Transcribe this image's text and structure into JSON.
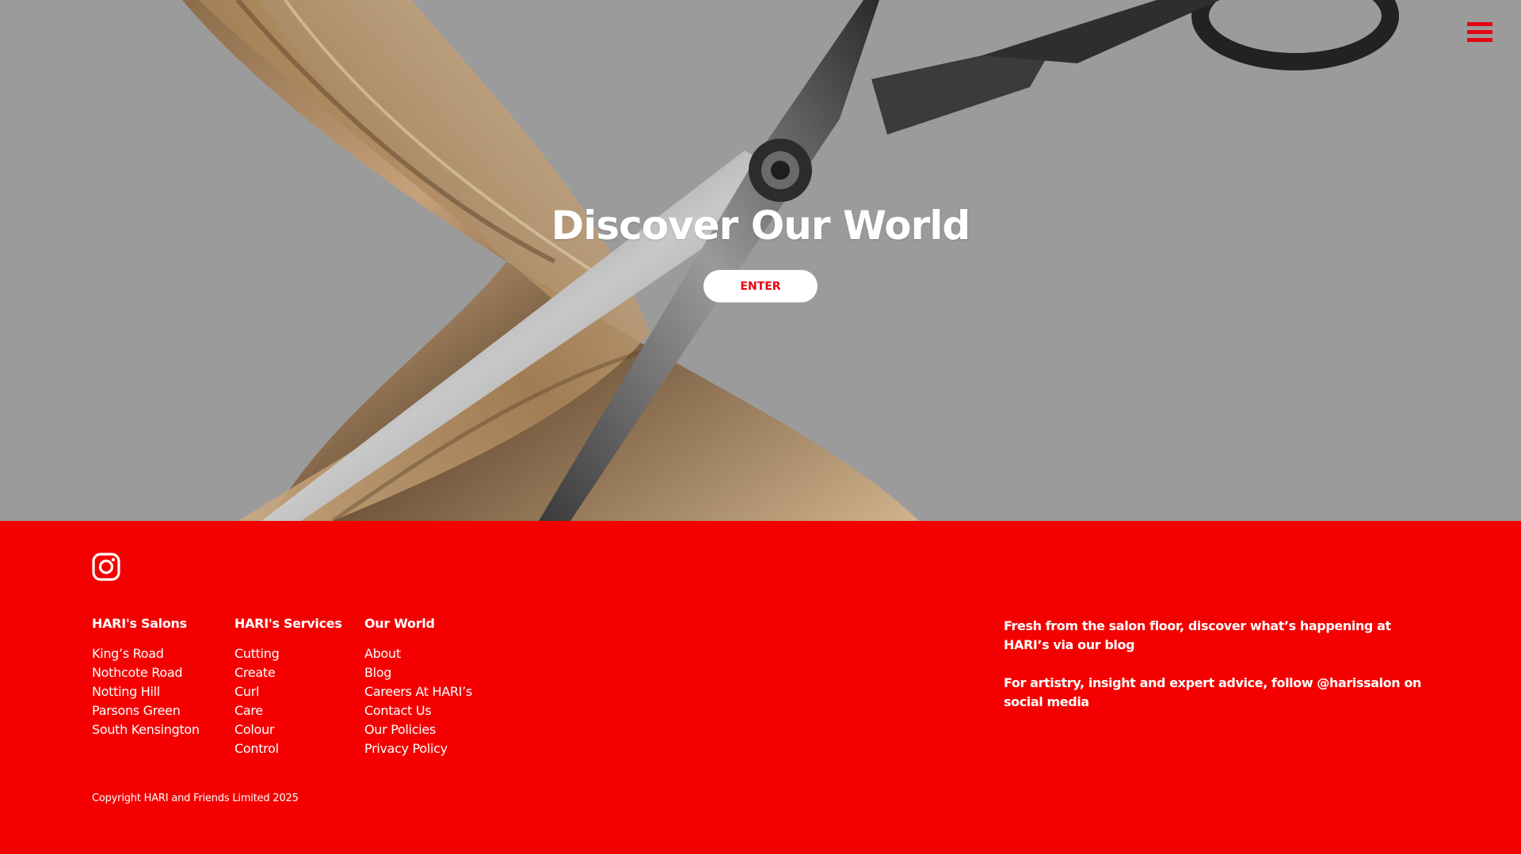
{
  "hero": {
    "title": "Discover Our World",
    "enter_label": "ENTER",
    "background_description_icon": "hair-and-scissors-photo"
  },
  "menu": {
    "icon": "hamburger-menu-icon"
  },
  "colors": {
    "brand_red": "#f50000",
    "button_text_red": "#e30613",
    "hero_overlay": "#9b9b9b"
  },
  "footer": {
    "social_icon": "instagram-icon",
    "salons": {
      "heading": "HARI's Salons",
      "items": [
        "King’s Road",
        "Nothcote Road",
        "Notting Hill",
        "Parsons Green",
        "South Kensington"
      ]
    },
    "services": {
      "heading": "HARI's Services",
      "items": [
        "Cutting",
        "Create",
        "Curl",
        "Care",
        "Colour",
        "Control"
      ]
    },
    "world": {
      "heading": "Our World",
      "items": [
        "About",
        "Blog",
        "Careers At HARI’s",
        "Contact Us",
        "Our Policies",
        "Privacy Policy"
      ]
    },
    "blurb": [
      "Fresh from the salon floor, discover what’s happening at HARI’s via our blog",
      "For artistry, insight and expert advice, follow @harissalon on social media"
    ],
    "copyright": "Copyright HARI and Friends Limited 2025"
  }
}
